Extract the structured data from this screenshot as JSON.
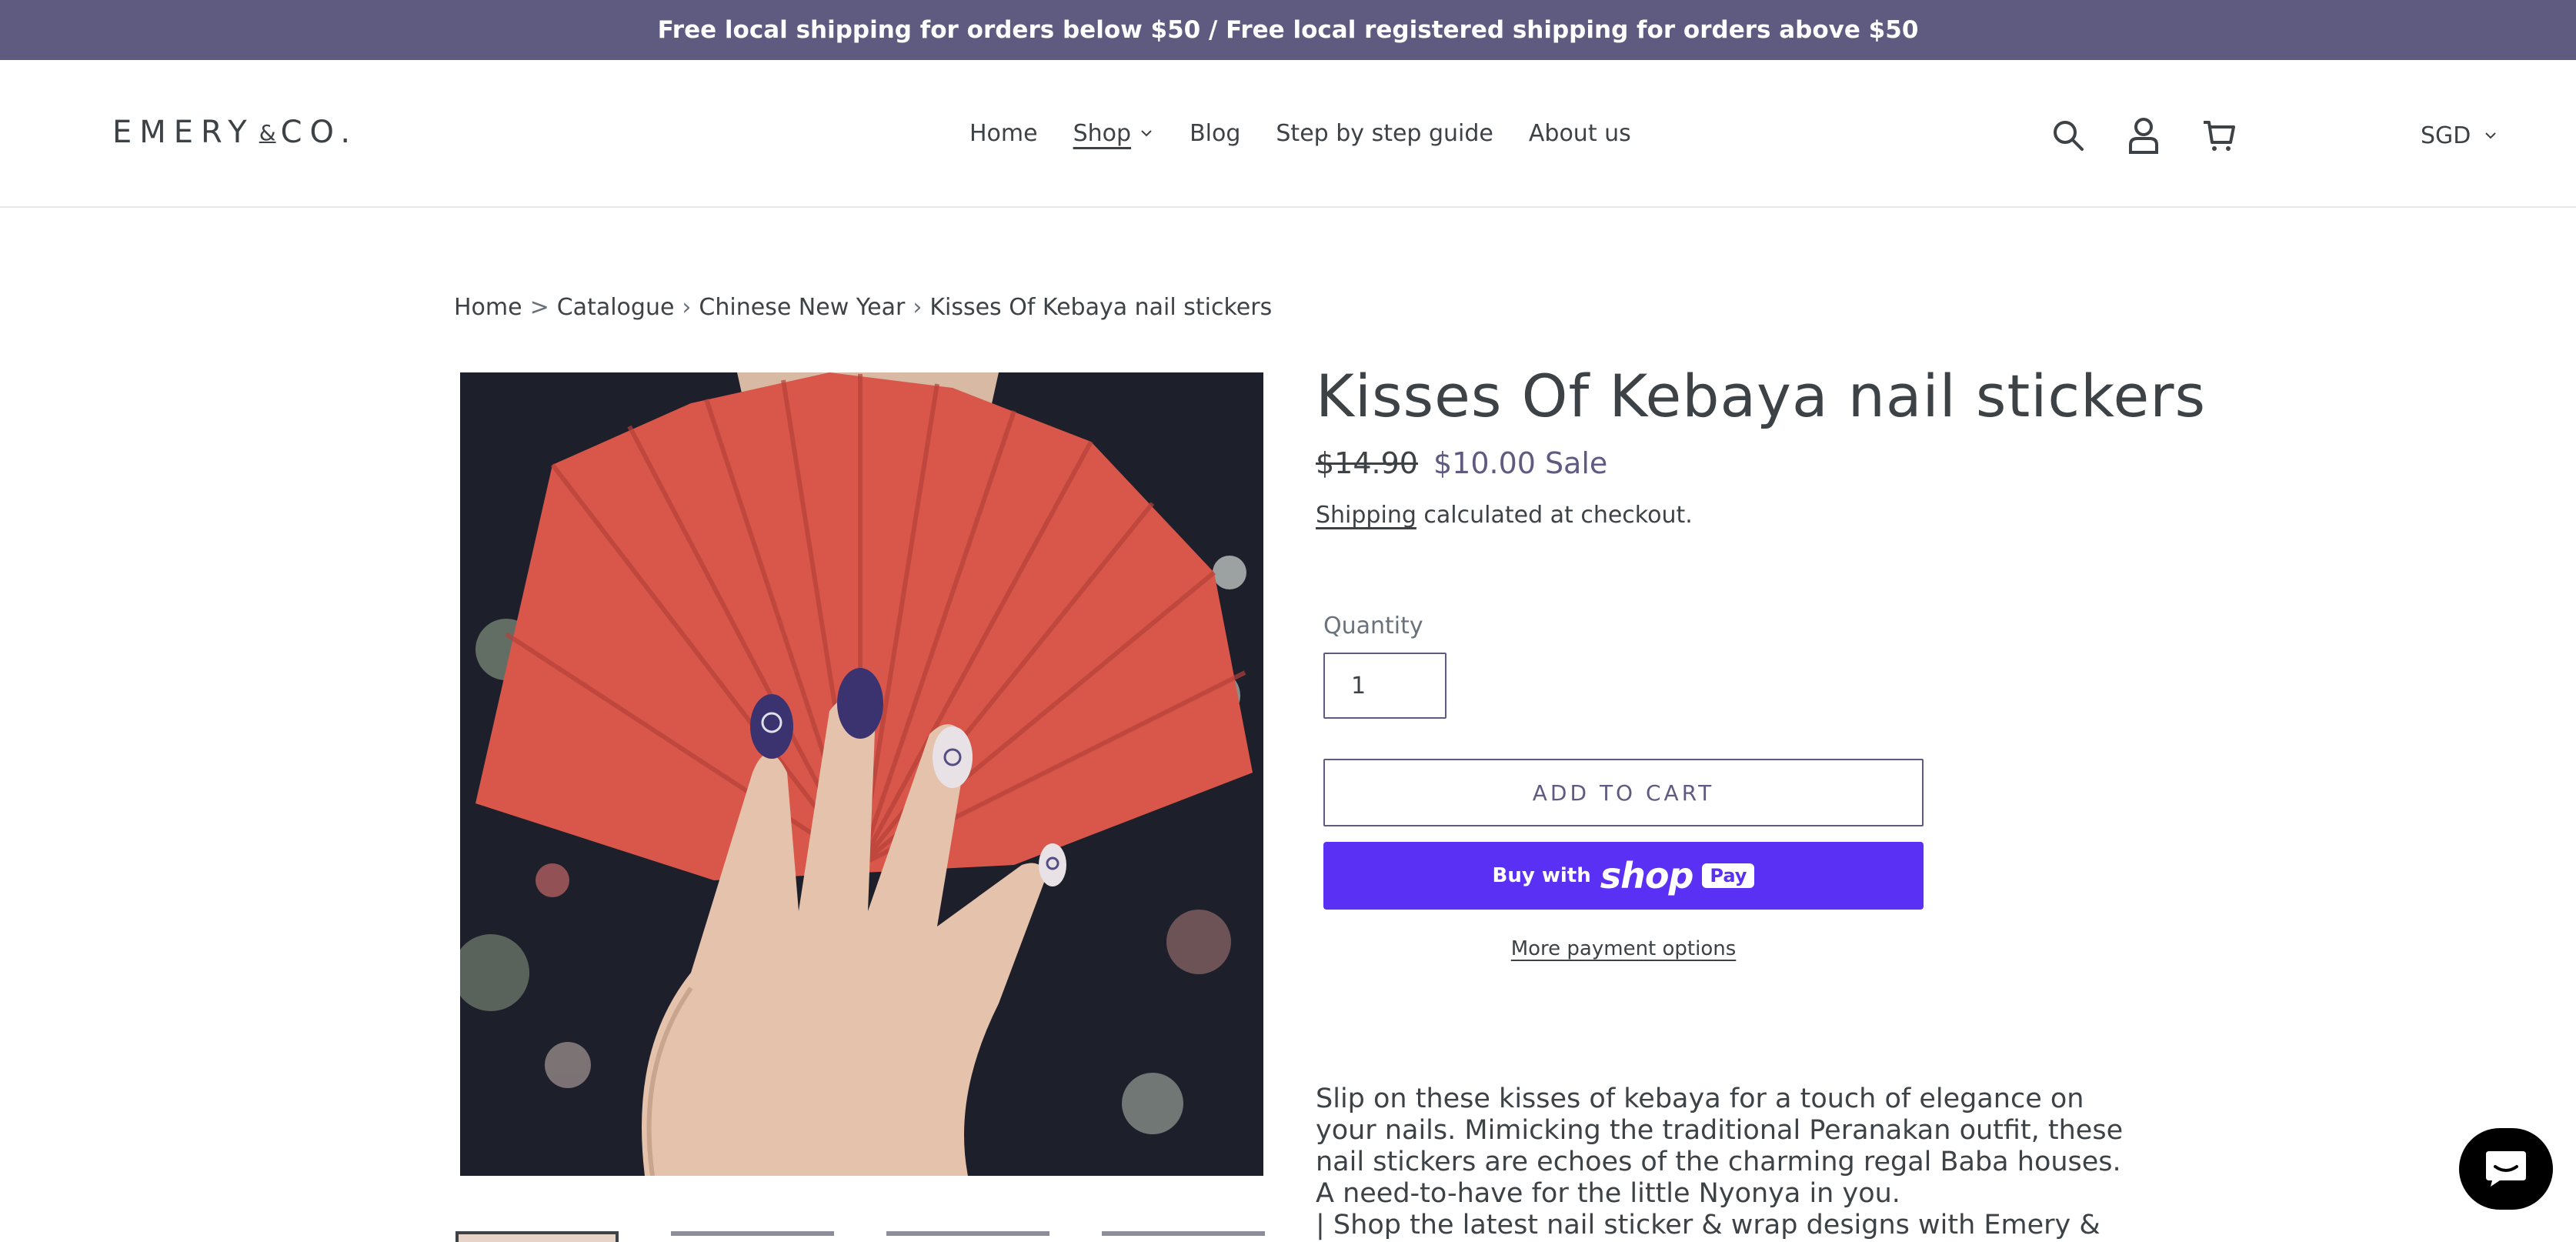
{
  "announcement": {
    "text": "Free local shipping for orders below $50 / Free local registered shipping for orders above $50"
  },
  "header": {
    "logo_main": "EMERY",
    "logo_amp": "&",
    "logo_end": "CO.",
    "nav": [
      {
        "label": "Home"
      },
      {
        "label": "Shop"
      },
      {
        "label": "Blog"
      },
      {
        "label": "Step by step guide"
      },
      {
        "label": "About us"
      }
    ],
    "icons": [
      "search-icon",
      "account-icon",
      "cart-icon"
    ],
    "currency": "SGD"
  },
  "breadcrumb": {
    "home": "Home",
    "sep1": ">",
    "catalogue": "Catalogue",
    "sep2": "›",
    "collection": "Chinese New Year",
    "sep3": "›",
    "product": "Kisses Of Kebaya nail stickers"
  },
  "product": {
    "title": "Kisses Of Kebaya nail stickers",
    "price_original": "$14.90",
    "price_sale": "$10.00",
    "sale_label": "Sale",
    "shipping_link": "Shipping",
    "shipping_text": " calculated at checkout.",
    "quantity_label": "Quantity",
    "quantity_value": "1",
    "add_to_cart": "ADD TO CART",
    "buy_with": "Buy with",
    "shop_brand": "shop",
    "pay_badge": "Pay",
    "more_payment": "More payment options",
    "description": [
      "Slip on these kisses of kebaya for a touch of elegance on your nails. Mimicking the traditional Peranakan outfit, these nail stickers are echoes of the charming regal Baba houses. A need-to-have for the little Nyonya in you.",
      "| Shop the latest nail sticker & wrap designs with Emery & Co."
    ]
  },
  "colors": {
    "announcement_bg": "#5f5a80",
    "accent": "#5f5a80",
    "shop_pay": "#5a31f4",
    "fan_red": "#d9574a",
    "nail_navy": "#3a3370"
  }
}
